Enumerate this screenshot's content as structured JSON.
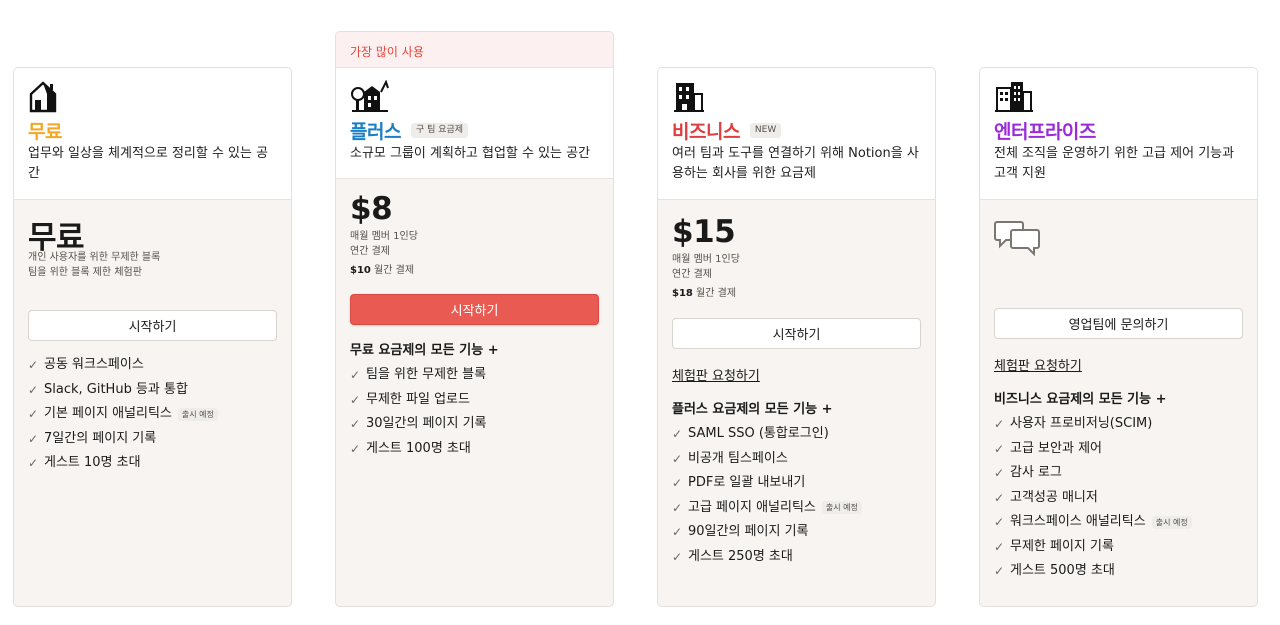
{
  "plans": [
    {
      "key": "free",
      "title": "무료",
      "title_color": "#f5a623",
      "description": "업무와 일상을 체계적으로 정리할 수 있는 공간",
      "price": "무료",
      "price_sub1": "개인 사용자를 위한 무제한 블록",
      "price_sub2": "팀을 위한 블록 제한 체험판",
      "button": "시작하기",
      "features": [
        {
          "text": "공동 워크스페이스"
        },
        {
          "text": "Slack, GitHub 등과 통합"
        },
        {
          "text": "기본 페이지 애널리틱스",
          "badge": "출시 예정"
        },
        {
          "text": "7일간의 페이지 기록"
        },
        {
          "text": "게스트 10명 초대"
        }
      ]
    },
    {
      "key": "plus",
      "ribbon": "가장 많이 사용",
      "title": "플러스",
      "title_color": "#1b7fc6",
      "tag": "구 팀 요금제",
      "description": "소규모 그룹이 계획하고 협업할 수 있는 공간",
      "price": "$8",
      "price_sub1": "매월 멤버 1인당",
      "price_sub2": "연간 결제",
      "price_monthly_amount": "$10",
      "price_monthly_text": " 월간 결제",
      "button": "시작하기",
      "features_header": "무료 요금제의 모든 기능 +",
      "features": [
        {
          "text": "팀을 위한 무제한 블록"
        },
        {
          "text": "무제한 파일 업로드"
        },
        {
          "text": "30일간의 페이지 기록"
        },
        {
          "text": "게스트 100명 초대"
        }
      ]
    },
    {
      "key": "business",
      "title": "비즈니스",
      "title_color": "#e03e3e",
      "tag": "NEW",
      "description": "여러 팀과 도구를 연결하기 위해 Notion을 사용하는 회사를 위한 요금제",
      "price": "$15",
      "price_sub1": "매월 멤버 1인당",
      "price_sub2": "연간 결제",
      "price_monthly_amount": "$18",
      "price_monthly_text": " 월간 결제",
      "button": "시작하기",
      "trial_link": "체험판 요청하기",
      "features_header": "플러스 요금제의 모든 기능 +",
      "features": [
        {
          "text": "SAML SSO (통합로그인)"
        },
        {
          "text": "비공개 팀스페이스"
        },
        {
          "text": "PDF로 일괄 내보내기"
        },
        {
          "text": "고급 페이지 애널리틱스",
          "badge": "출시 예정"
        },
        {
          "text": "90일간의 페이지 기록"
        },
        {
          "text": "게스트 250명 초대"
        }
      ]
    },
    {
      "key": "enterprise",
      "title": "엔터프라이즈",
      "title_color": "#9b2bd8",
      "description": "전체 조직을 운영하기 위한 고급 제어 기능과 고객 지원",
      "button": "영업팀에 문의하기",
      "trial_link": "체험판 요청하기",
      "features_header": "비즈니스 요금제의 모든 기능 +",
      "features": [
        {
          "text": "사용자 프로비저닝(SCIM)"
        },
        {
          "text": "고급 보안과 제어"
        },
        {
          "text": "감사 로그"
        },
        {
          "text": "고객성공 매니저"
        },
        {
          "text": "워크스페이스 애널리틱스",
          "badge": "출시 예정"
        },
        {
          "text": "무제한 페이지 기록"
        },
        {
          "text": "게스트 500명 초대"
        }
      ]
    }
  ],
  "check_glyph": "✓"
}
